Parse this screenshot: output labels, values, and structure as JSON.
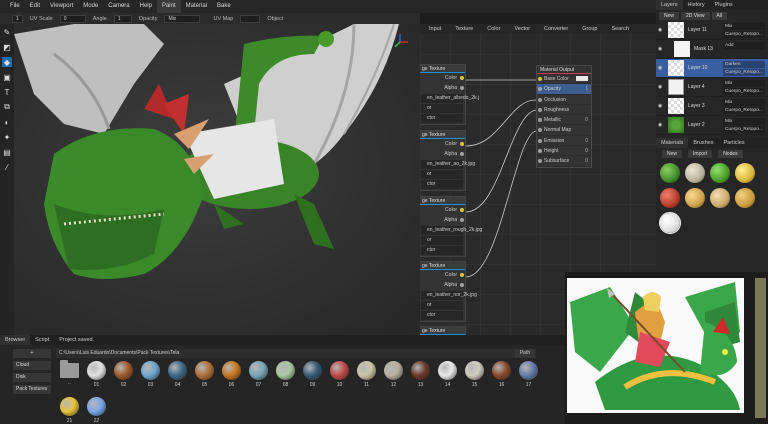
{
  "menubar": {
    "items": [
      "File",
      "Edit",
      "Viewport",
      "Mode",
      "Camera",
      "Help",
      "Paint",
      "Material",
      "Bake"
    ],
    "active_index": 6
  },
  "toolbar": {
    "brush_size": "1",
    "uv_scale_label": "UV Scale",
    "uv_scale_value": "0",
    "angle_label": "Angle",
    "angle_value": "1",
    "opacity_label": "Opacity",
    "blend_value": "Mix",
    "uvmap_label": "UV Map",
    "object_label": "Object"
  },
  "lefttools": [
    "brush-icon",
    "eraser-icon",
    "fill-icon",
    "decal-icon",
    "text-icon",
    "clone-icon",
    "blur-icon",
    "particle-icon",
    "colorid-icon",
    "picker-icon"
  ],
  "node_editor": {
    "menu": [
      "Input",
      "Texture",
      "Color",
      "Vector",
      "Converter",
      "Group",
      "Search"
    ],
    "texture_nodes": [
      {
        "title": "ge Texture",
        "color_label": "Color",
        "alpha_label": "Alpha",
        "file": "en_leather_albedo_2k.j",
        "rows": [
          "or",
          "ctor"
        ]
      },
      {
        "title": "ge Texture",
        "color_label": "Color",
        "alpha_label": "Alpha",
        "file": "en_leather_ao_2k.jpg",
        "rows": [
          "or",
          "ctor"
        ]
      },
      {
        "title": "ge Texture",
        "color_label": "Color",
        "alpha_label": "Alpha",
        "file": "en_leather_rough_2k.jpg",
        "rows": [
          "or",
          "ctor"
        ]
      },
      {
        "title": "ge Texture",
        "color_label": "Color",
        "alpha_label": "Alpha",
        "file": "en_leather_nor_2k.jpg",
        "rows": [
          "or",
          "ctor"
        ]
      }
    ],
    "bottom_node_title": "ge Texture",
    "material_output": {
      "title": "Material Output",
      "rows": [
        {
          "label": "Base Color",
          "value": ""
        },
        {
          "label": "Opacity",
          "value": "1"
        },
        {
          "label": "Occlusion",
          "value": ""
        },
        {
          "label": "Roughness",
          "value": ""
        },
        {
          "label": "Metallic",
          "value": "0"
        },
        {
          "label": "Normal Map",
          "value": ""
        },
        {
          "label": "Emission",
          "value": "0"
        },
        {
          "label": "Height",
          "value": "0"
        },
        {
          "label": "Subsurface",
          "value": "0"
        }
      ]
    }
  },
  "layers_panel": {
    "tabs": [
      "Layers",
      "History",
      "Plugins"
    ],
    "buttons": [
      "New",
      "2D View",
      "All"
    ],
    "layers": [
      {
        "name": "Layer 11",
        "blend": "Mix",
        "target": "Cuerpo_Retopo...",
        "selected": false,
        "thumb": "checker"
      },
      {
        "name": "Mask 13",
        "blend": "Add",
        "target": "",
        "selected": false,
        "thumb": "white"
      },
      {
        "name": "Layer 10",
        "blend": "Darken",
        "target": "Cuerpo_Retopo...",
        "selected": true,
        "thumb": "checker"
      },
      {
        "name": "Layer 4",
        "blend": "Mix",
        "target": "Cuerpo_Retopo...",
        "selected": false,
        "thumb": "sketch"
      },
      {
        "name": "Layer 3",
        "blend": "Mix",
        "target": "Cuerpo_Retopo...",
        "selected": false,
        "thumb": "checker"
      },
      {
        "name": "Layer 2",
        "blend": "Mix",
        "target": "Cuerpo_Retopo...",
        "selected": false,
        "thumb": "green"
      }
    ]
  },
  "materials_panel": {
    "tabs": [
      "Materials",
      "Brushes",
      "Particles"
    ],
    "buttons": [
      "New",
      "Import",
      "Nodes"
    ],
    "swatches": [
      "#3f8a2a",
      "#b9b29a",
      "#4a9a2a",
      "#d9b43a",
      "#b83a2a",
      "#caa04a",
      "#caa86a",
      "#c89a3a",
      "#e0e0e0"
    ]
  },
  "bottom_panel": {
    "tabs": [
      "Browser",
      "Script",
      "Project saved."
    ],
    "side_buttons": [
      "+",
      "Cloud",
      "Disk",
      "Pack Textures"
    ],
    "path": "C:\\Users\\Luis Eduardo\\Documents\\Pack Textures\\Tela",
    "path_button": "Path",
    "assets": [
      {
        "label": "..",
        "kind": "folder",
        "color": ""
      },
      {
        "label": "01",
        "kind": "ball",
        "color": "#e2e2e2"
      },
      {
        "label": "02",
        "kind": "ball",
        "color": "#a0582a"
      },
      {
        "label": "03",
        "kind": "ball",
        "color": "#6fa8cf"
      },
      {
        "label": "04",
        "kind": "ball",
        "color": "#3f6a8a"
      },
      {
        "label": "05",
        "kind": "ball",
        "color": "#b0703a"
      },
      {
        "label": "06",
        "kind": "ball",
        "color": "#c7781e"
      },
      {
        "label": "07",
        "kind": "ball",
        "color": "#7aa6b8"
      },
      {
        "label": "08",
        "kind": "ball",
        "color": "#a8c8a0"
      },
      {
        "label": "09",
        "kind": "ball",
        "color": "#3a5a78"
      },
      {
        "label": "10",
        "kind": "ball",
        "color": "#c24a4a"
      },
      {
        "label": "11",
        "kind": "ball",
        "color": "#c8c6a8"
      },
      {
        "label": "12",
        "kind": "ball",
        "color": "#b8b0a0"
      },
      {
        "label": "13",
        "kind": "ball",
        "color": "#6a3a2a"
      },
      {
        "label": "14",
        "kind": "ball",
        "color": "#e8e8e8"
      },
      {
        "label": "15",
        "kind": "ball",
        "color": "#d0ccc0"
      },
      {
        "label": "16",
        "kind": "ball",
        "color": "#8a4a2a"
      },
      {
        "label": "17",
        "kind": "ball",
        "color": "#6a7aa8"
      },
      {
        "label": "21",
        "kind": "ball",
        "color": "#e8c23a"
      },
      {
        "label": "22",
        "kind": "ball",
        "color": "#7aa6e8"
      }
    ]
  },
  "colors": {
    "accent": "#1f8fd6",
    "selected_layer": "#3a5fa0",
    "panel": "#262626"
  }
}
